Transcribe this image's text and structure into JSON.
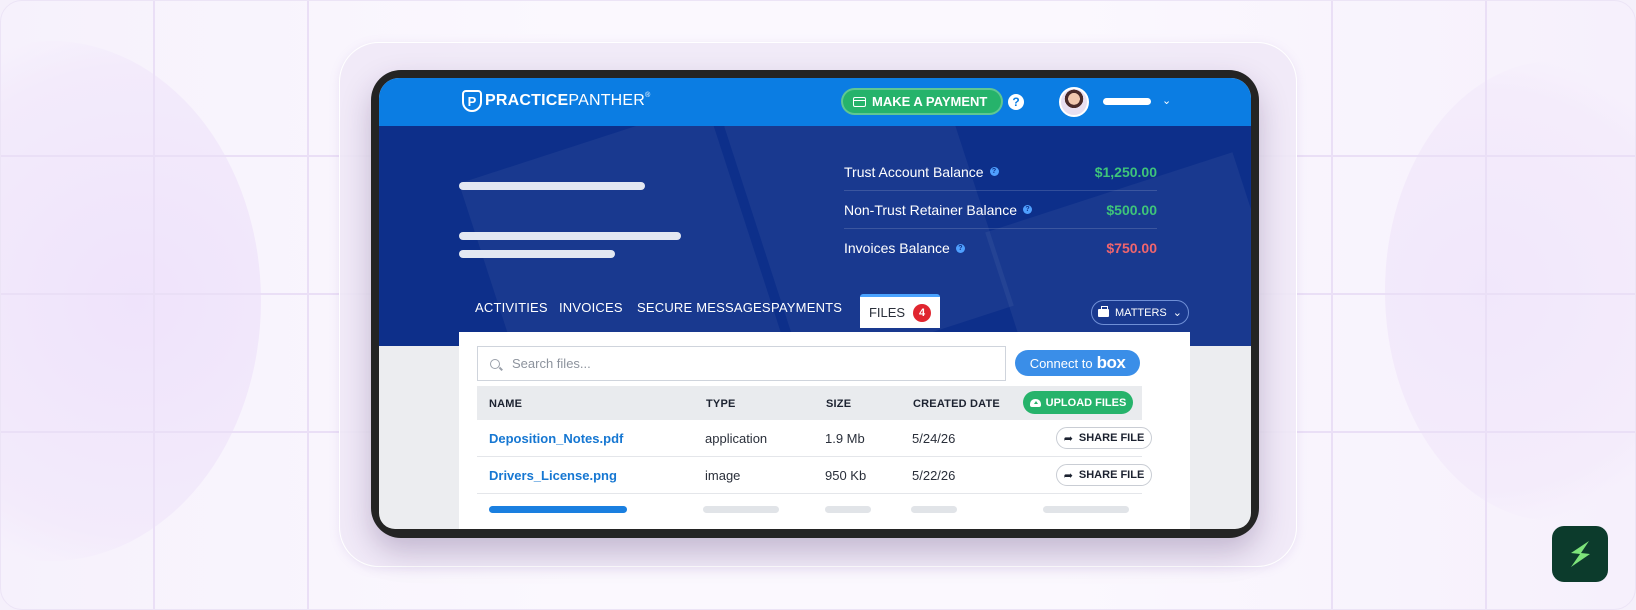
{
  "header": {
    "logo_bold": "PRACTICE",
    "logo_light": "PANTHER",
    "logo_reg": "®",
    "pay_button": "MAKE A PAYMENT",
    "help": "?"
  },
  "balances": [
    {
      "label": "Trust Account Balance",
      "value": "$1,250.00",
      "color": "#3ec47a"
    },
    {
      "label": "Non-Trust Retainer Balance",
      "value": "$500.00",
      "color": "#3ec47a"
    },
    {
      "label": "Invoices Balance",
      "value": "$750.00",
      "color": "#f0656d"
    }
  ],
  "tabs": {
    "activities": "ACTIVITIES",
    "invoices": "INVOICES",
    "secure_messages": "SECURE MESSAGES",
    "payments": "PAYMENTS",
    "files": "FILES",
    "files_count": "4"
  },
  "matters_button": "MATTERS",
  "search": {
    "placeholder": "Search files..."
  },
  "box_button": {
    "label": "Connect to",
    "brand": "box"
  },
  "table": {
    "headers": {
      "name": "NAME",
      "type": "TYPE",
      "size": "SIZE",
      "created": "CREATED DATE"
    },
    "upload_button": "UPLOAD FILES",
    "rows": [
      {
        "name": "Deposition_Notes.pdf",
        "type": "application",
        "size": "1.9 Mb",
        "created": "5/24/26",
        "action": "SHARE FILE"
      },
      {
        "name": "Drivers_License.png",
        "type": "image",
        "size": "950 Kb",
        "created": "5/22/26",
        "action": "SHARE FILE"
      }
    ]
  },
  "colors": {
    "topbar": "#0b7de3",
    "hero": "#0d2f8a",
    "accent_green": "#26b36b",
    "link_blue": "#1677d2",
    "badge_red": "#e0252f"
  }
}
